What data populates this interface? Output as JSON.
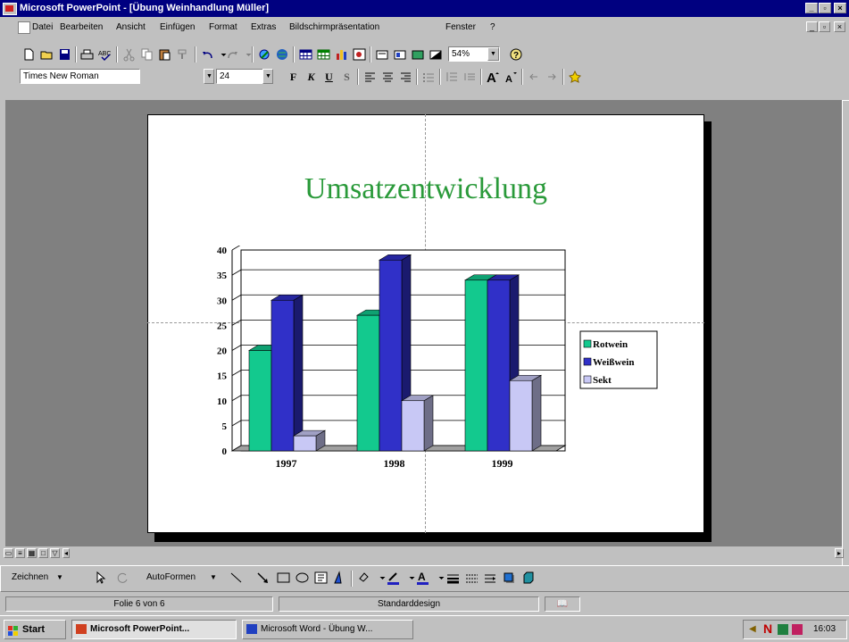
{
  "window": {
    "title": "Microsoft PowerPoint - [Übung Weinhandlung Müller]"
  },
  "menu": {
    "items": [
      "Datei",
      "Bearbeiten",
      "Ansicht",
      "Einfügen",
      "Format",
      "Extras",
      "Bildschirmpräsentation",
      "Fenster",
      "?"
    ]
  },
  "toolbar": {
    "zoom": "54%",
    "font_name": "Times New Roman",
    "font_size": "24",
    "bold_label": "F",
    "italic_label": "K",
    "underline_label": "U",
    "shadow_label": "S"
  },
  "slide": {
    "title": "Umsatzentwicklung"
  },
  "chart_data": {
    "type": "bar",
    "categories": [
      "1997",
      "1998",
      "1999"
    ],
    "series": [
      {
        "name": "Rotwein",
        "values": [
          20,
          27,
          34
        ],
        "color": "#13c98e"
      },
      {
        "name": "Weißwein",
        "values": [
          30,
          38,
          34
        ],
        "color": "#3030c8"
      },
      {
        "name": "Sekt",
        "values": [
          3,
          10,
          14
        ],
        "color": "#c8c8f5"
      }
    ],
    "ylim": [
      0,
      40
    ],
    "yticks": [
      "0",
      "5",
      "10",
      "15",
      "20",
      "25",
      "30",
      "35",
      "40"
    ],
    "grid": true,
    "legend": "right"
  },
  "drawbar": {
    "draw_label": "Zeichnen",
    "autoshapes_label": "AutoFormen"
  },
  "status": {
    "slide_info": "Folie 6 von 6",
    "design": "Standarddesign"
  },
  "taskbar": {
    "start_label": "Start",
    "tasks": [
      "Microsoft PowerPoint...",
      "Microsoft Word - Übung W..."
    ],
    "clock": "16:03"
  }
}
